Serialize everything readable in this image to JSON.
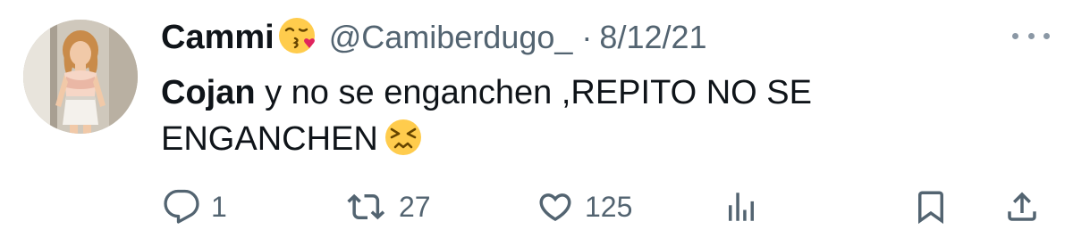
{
  "tweet": {
    "display_name": "Cammi",
    "name_emoji": "face-blowing-a-kiss-emoji",
    "handle": "@Camiberdugo_",
    "separator": "·",
    "date": "8/12/21",
    "text_bold": "Cojan",
    "text_rest": " y no se enganchen ,REPITO NO SE ENGANCHEN",
    "text_emoji": "persevering-face-emoji"
  },
  "actions": {
    "reply": {
      "icon": "reply-icon",
      "count": "1"
    },
    "retweet": {
      "icon": "retweet-icon",
      "count": "27"
    },
    "like": {
      "icon": "heart-icon",
      "count": "125"
    },
    "views": {
      "icon": "analytics-icon"
    },
    "bookmark": {
      "icon": "bookmark-icon"
    },
    "share": {
      "icon": "share-icon"
    }
  },
  "colors": {
    "text_primary": "#0f1419",
    "text_secondary": "#536471",
    "emoji_yellow": "#ffcc4d",
    "heart_red": "#e0245e"
  }
}
